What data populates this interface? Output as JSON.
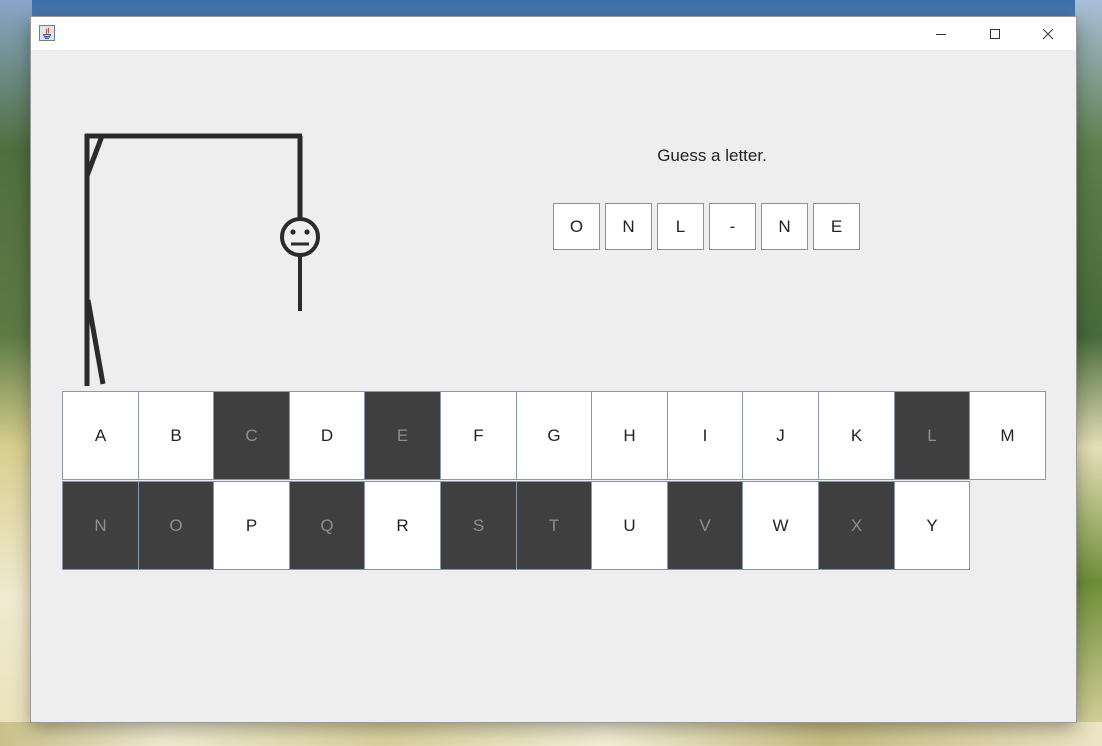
{
  "window": {
    "title": "",
    "controls": {
      "minimize": "minimize-icon",
      "maximize": "maximize-icon",
      "close": "close-icon"
    }
  },
  "game": {
    "status_text": "Guess a letter.",
    "word": [
      "O",
      "N",
      "L",
      "-",
      "N",
      "E"
    ],
    "keyboard": {
      "row1": [
        {
          "letter": "A",
          "used": false
        },
        {
          "letter": "B",
          "used": false
        },
        {
          "letter": "C",
          "used": true
        },
        {
          "letter": "D",
          "used": false
        },
        {
          "letter": "E",
          "used": true
        },
        {
          "letter": "F",
          "used": false
        },
        {
          "letter": "G",
          "used": false
        },
        {
          "letter": "H",
          "used": false
        },
        {
          "letter": "I",
          "used": false
        },
        {
          "letter": "J",
          "used": false
        },
        {
          "letter": "K",
          "used": false
        },
        {
          "letter": "L",
          "used": true
        },
        {
          "letter": "M",
          "used": false
        }
      ],
      "row2": [
        {
          "letter": "N",
          "used": true
        },
        {
          "letter": "O",
          "used": true
        },
        {
          "letter": "P",
          "used": false
        },
        {
          "letter": "Q",
          "used": true
        },
        {
          "letter": "R",
          "used": false
        },
        {
          "letter": "S",
          "used": true
        },
        {
          "letter": "T",
          "used": true
        },
        {
          "letter": "U",
          "used": false
        },
        {
          "letter": "V",
          "used": true
        },
        {
          "letter": "W",
          "used": false
        },
        {
          "letter": "X",
          "used": true
        },
        {
          "letter": "Y",
          "used": false
        }
      ]
    },
    "colors": {
      "key_available": "#ffffff",
      "key_used": "#3f3f3f",
      "key_border": "#8898ab",
      "gallows_stroke": "#2b2b2b"
    }
  }
}
